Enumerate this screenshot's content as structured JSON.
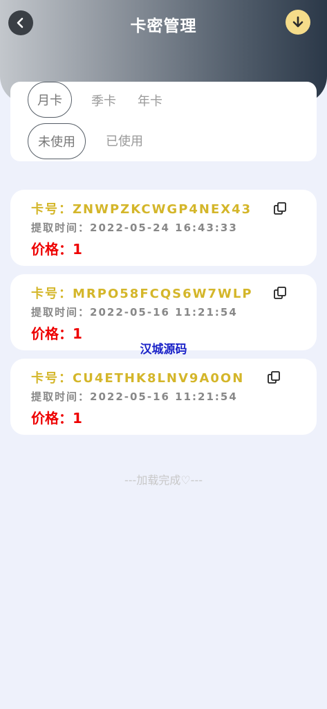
{
  "header": {
    "title": "卡密管理",
    "back_icon": "chevron-left-icon",
    "download_icon": "arrow-down-circle-icon"
  },
  "filters": {
    "period_tabs": [
      {
        "label": "月卡",
        "active": true
      },
      {
        "label": "季卡",
        "active": false
      },
      {
        "label": "年卡",
        "active": false
      }
    ],
    "status_tabs": [
      {
        "label": "未使用",
        "active": true
      },
      {
        "label": "已使用",
        "active": false
      }
    ]
  },
  "cards": [
    {
      "card_label": "卡号：",
      "card_no": "ZNWPZKCWGP4NEX43",
      "time_label": "提取时间：",
      "time": "2022-05-24 16:43:33",
      "price_label": "价格：",
      "price": "1"
    },
    {
      "card_label": "卡号：",
      "card_no": "MRPO58FCQS6W7WLP",
      "time_label": "提取时间：",
      "time": "2022-05-16 11:21:54",
      "price_label": "价格：",
      "price": "1"
    },
    {
      "card_label": "卡号：",
      "card_no": "CU4ETHK8LNV9A0ON",
      "time_label": "提取时间：",
      "time": "2022-05-16 11:21:54",
      "price_label": "价格：",
      "price": "1"
    }
  ],
  "watermark": "汉城源码",
  "load_status": "---加载完成♡---",
  "colors": {
    "accent_gold": "#d4b62a",
    "price_red": "#ee0000",
    "page_bg": "#eef1fb"
  }
}
